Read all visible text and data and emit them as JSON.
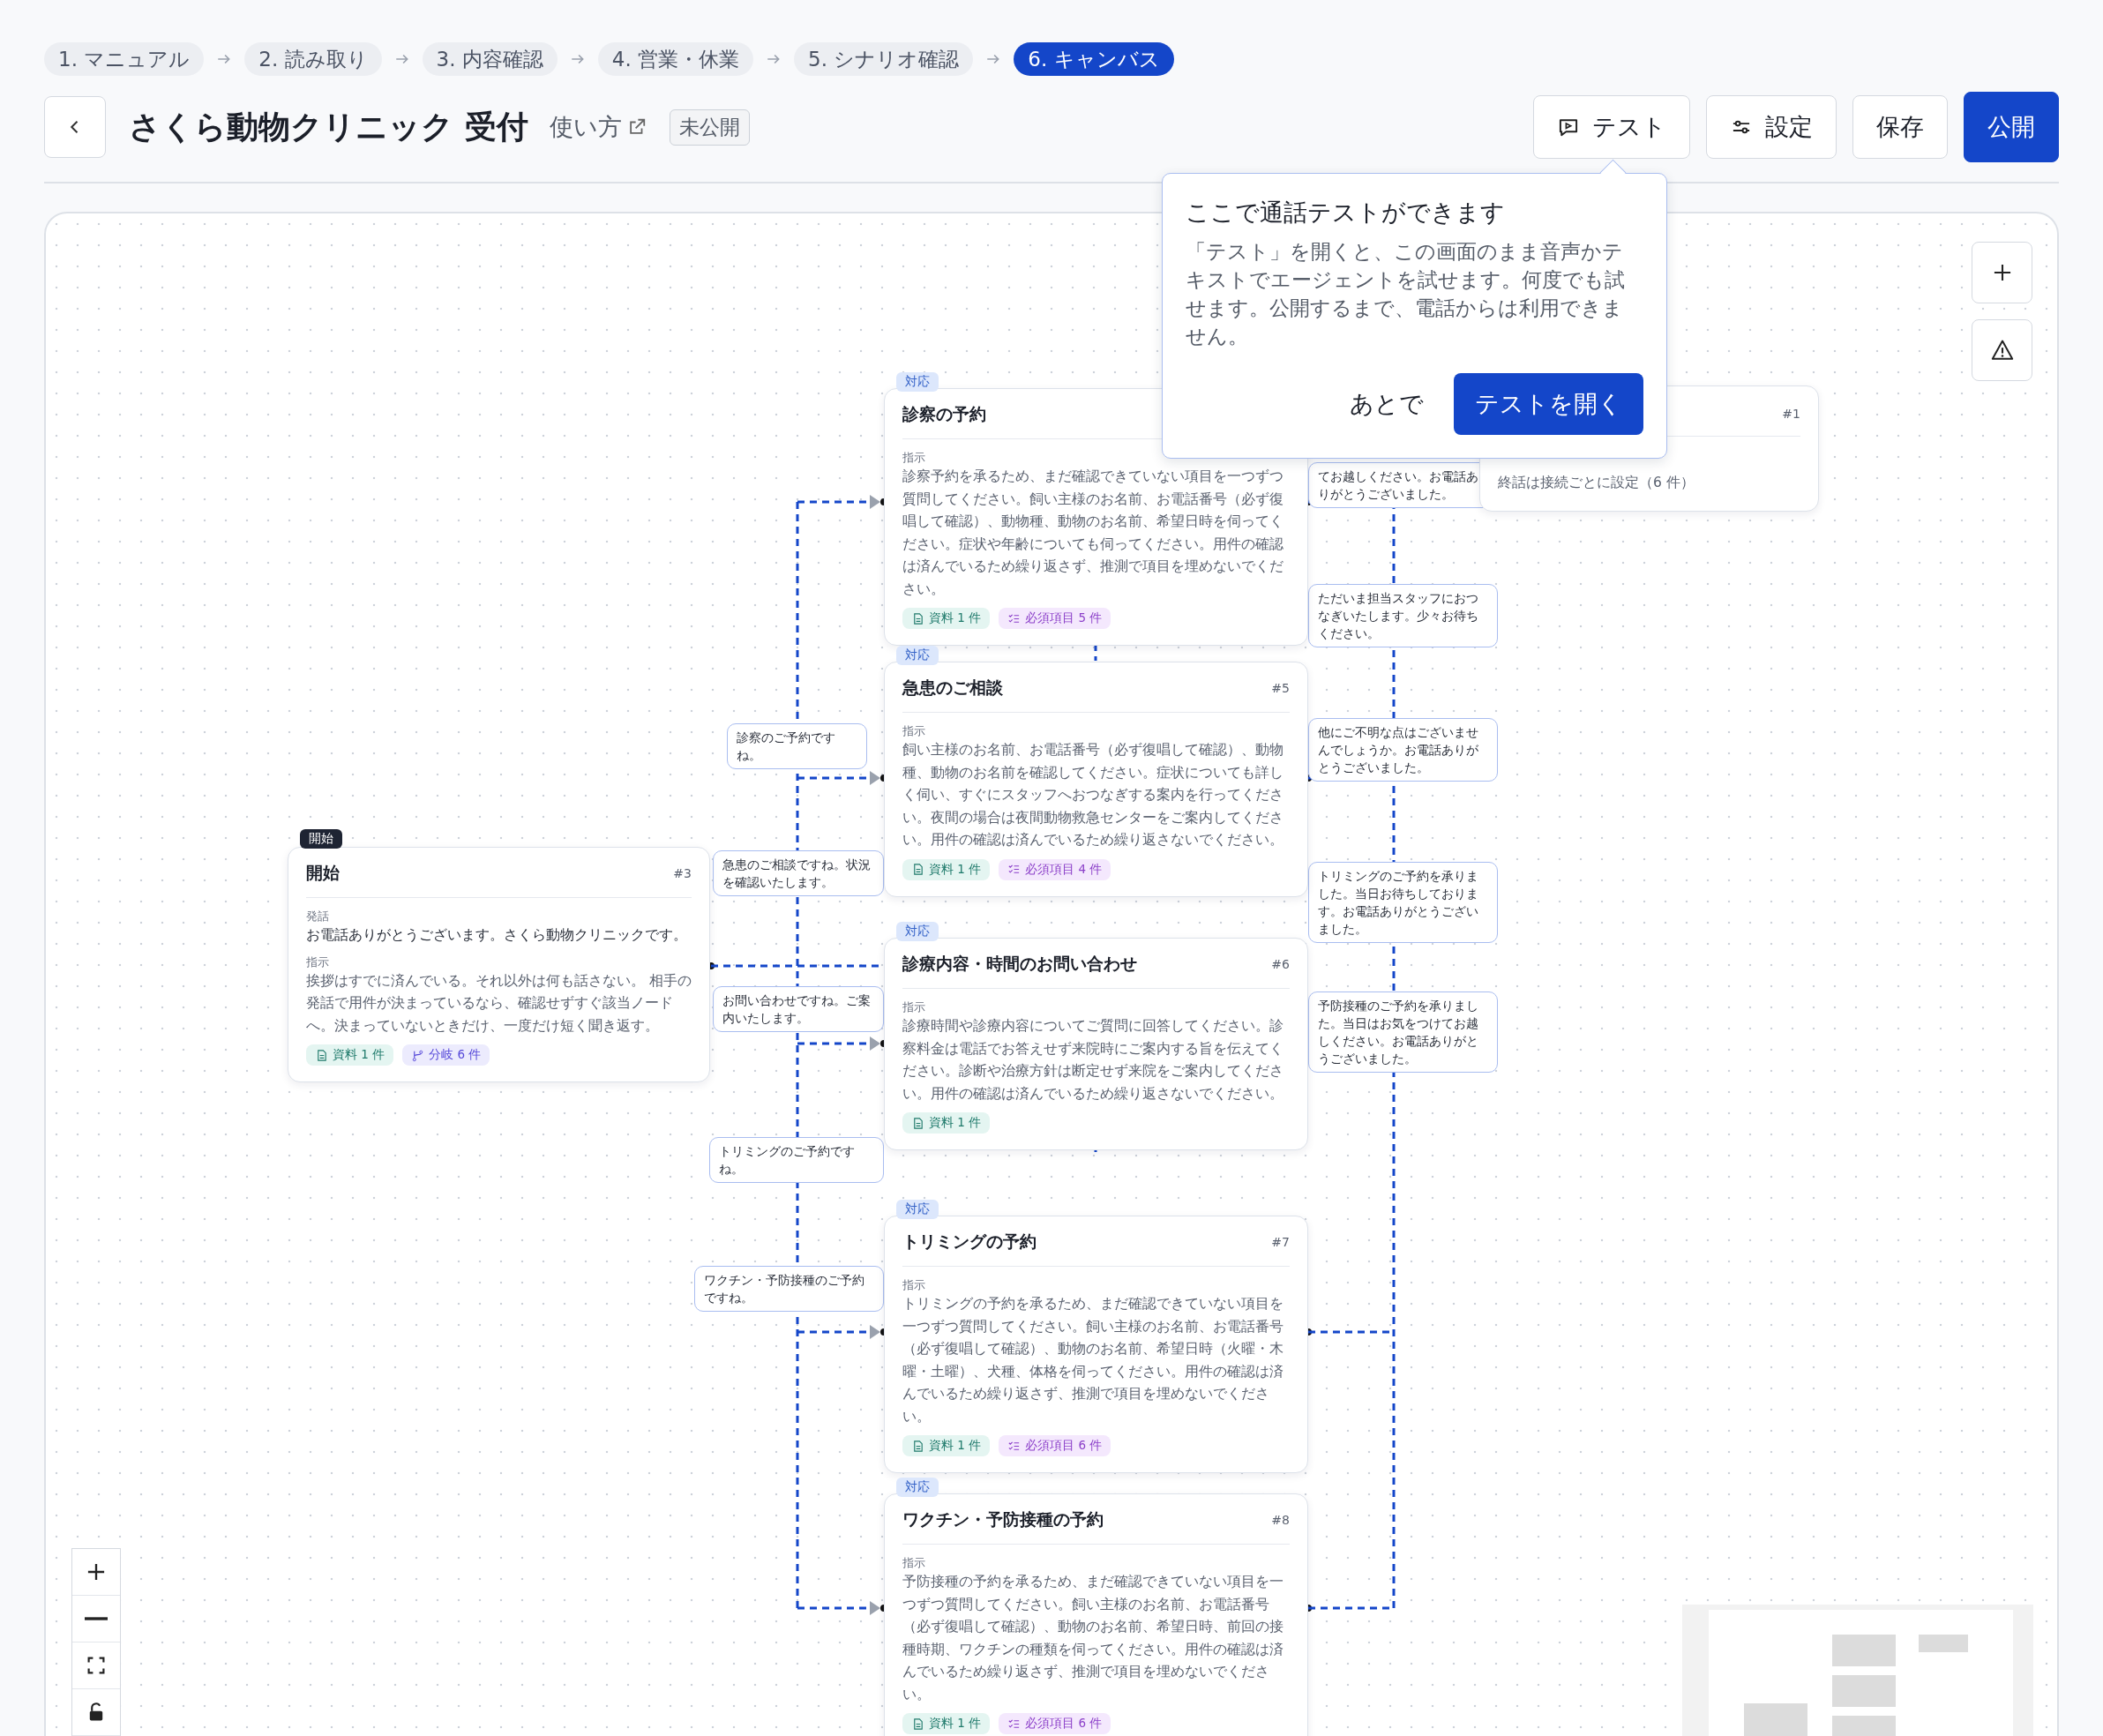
{
  "steps": [
    {
      "label": "1. マニュアル",
      "selected": false
    },
    {
      "label": "2. 読み取り",
      "selected": false
    },
    {
      "label": "3. 内容確認",
      "selected": false
    },
    {
      "label": "4. 営業・休業",
      "selected": false
    },
    {
      "label": "5. シナリオ確認",
      "selected": false
    },
    {
      "label": "6. キャンバス",
      "selected": true
    }
  ],
  "header": {
    "title": "さくら動物クリニック 受付",
    "help_link": "使い方",
    "status_badge": "未公開",
    "buttons": [
      {
        "label": "テスト",
        "kind": "test"
      },
      {
        "label": "設定",
        "kind": "settings"
      },
      {
        "label": "保存",
        "kind": "save"
      },
      {
        "label": "公開",
        "kind": "publish"
      }
    ]
  },
  "popover": {
    "title": "ここで通話テストができます",
    "body": "「テスト」を開くと、この画面のまま音声かテキストでエージェントを試せます。何度でも試せます。公開するまで、電話からは利用できません。",
    "dismiss": "あとで",
    "confirm": "テストを開く"
  },
  "nodes": [
    {
      "kind": "start",
      "badge": "開始",
      "title": "開始",
      "number": "#3",
      "sections": [
        {
          "label": "発話",
          "text": "お電話ありがとうございます。さくら動物クリニックです。",
          "muted": false
        },
        {
          "label": "指示",
          "text": "挨拶はすでに済んでいる。それ以外は何も話さない。 相手の発話で用件が決まっているなら、確認せずすぐ該当ノードへ。決まっていないときだけ、一度だけ短く聞き返す。",
          "muted": true
        }
      ],
      "chips": [
        {
          "kind": "docs",
          "label": "資料 1 件"
        },
        {
          "kind": "branches",
          "label": "分岐 6 件"
        }
      ]
    },
    {
      "kind": "action",
      "badge": "対応",
      "title": "診察の予約",
      "sections": [
        {
          "label": "指示",
          "text": "診察予約を承るため、まだ確認できていない項目を一つずつ質問してください。飼い主様のお名前、お電話番号（必ず復唱して確認）、動物種、動物のお名前、希望日時を伺ってください。症状や年齢についても伺ってください。用件の確認は済んでいるため繰り返さず、推測で項目を埋めないでください。",
          "muted": true
        }
      ],
      "chips": [
        {
          "kind": "docs",
          "label": "資料 1 件"
        },
        {
          "kind": "required",
          "label": "必須項目 5 件"
        }
      ]
    },
    {
      "kind": "end",
      "number": "#1",
      "sections": [
        {
          "text": "終話は接続ごとに設定（6 件）",
          "muted": true
        }
      ]
    },
    {
      "kind": "action",
      "badge": "対応",
      "title": "急患のご相談",
      "number": "#5",
      "sections": [
        {
          "label": "指示",
          "text": "飼い主様のお名前、お電話番号（必ず復唱して確認）、動物種、動物のお名前を確認してください。症状についても詳しく伺い、すぐにスタッフへおつなぎする案内を行ってください。夜間の場合は夜間動物救急センターをご案内してください。用件の確認は済んでいるため繰り返さないでください。",
          "muted": true
        }
      ],
      "chips": [
        {
          "kind": "docs",
          "label": "資料 1 件"
        },
        {
          "kind": "required",
          "label": "必須項目 4 件"
        }
      ]
    },
    {
      "kind": "action",
      "badge": "対応",
      "title": "診療内容・時間のお問い合わせ",
      "number": "#6",
      "sections": [
        {
          "label": "指示",
          "text": "診療時間や診療内容についてご質問に回答してください。診察料金は電話でお答えせず来院時にご案内する旨を伝えてください。診断や治療方針は断定せず来院をご案内してください。用件の確認は済んでいるため繰り返さないでください。",
          "muted": true
        }
      ],
      "chips": [
        {
          "kind": "docs",
          "label": "資料 1 件"
        }
      ]
    },
    {
      "kind": "action",
      "badge": "対応",
      "title": "トリミングの予約",
      "number": "#7",
      "sections": [
        {
          "label": "指示",
          "text": "トリミングの予約を承るため、まだ確認できていない項目を一つずつ質問してください。飼い主様のお名前、お電話番号（必ず復唱して確認）、動物のお名前、希望日時（火曜・木曜・土曜）、犬種、体格を伺ってください。用件の確認は済んでいるため繰り返さず、推測で項目を埋めないでください。",
          "muted": true
        }
      ],
      "chips": [
        {
          "kind": "docs",
          "label": "資料 1 件"
        },
        {
          "kind": "required",
          "label": "必須項目 6 件"
        }
      ]
    },
    {
      "kind": "action",
      "badge": "対応",
      "title": "ワクチン・予防接種の予約",
      "number": "#8",
      "sections": [
        {
          "label": "指示",
          "text": "予防接種の予約を承るため、まだ確認できていない項目を一つずつ質問してください。飼い主様のお名前、お電話番号（必ず復唱して確認）、動物のお名前、希望日時、前回の接種時期、ワクチンの種類を伺ってください。用件の確認は済んでいるため繰り返さず、推測で項目を埋めないでください。",
          "muted": true
        }
      ],
      "chips": [
        {
          "kind": "docs",
          "label": "資料 1 件"
        },
        {
          "kind": "required",
          "label": "必須項目 6 件"
        }
      ]
    }
  ],
  "edge_labels": [
    {
      "text": "診察のご予約ですね。"
    },
    {
      "text": "急患のご相談ですね。状況を確認いたします。"
    },
    {
      "text": "お問い合わせですね。ご案内いたします。"
    },
    {
      "text": "トリミングのご予約ですね。"
    },
    {
      "text": "ワクチン・予防接種のご予約ですね。"
    },
    {
      "text": "てお越しください。お電話ありがとうございました。"
    },
    {
      "text": "ただいま担当スタッフにおつなぎいたします。少々お待ちください。"
    },
    {
      "text": "他にご不明な点はございませんでしょうか。お電話ありがとうございました。"
    },
    {
      "text": "トリミングのご予約を承りました。当日お待ちしております。お電話ありがとうございました。"
    },
    {
      "text": "予防接種のご予約を承りました。当日はお気をつけてお越しください。お電話ありがとうございました。"
    }
  ]
}
